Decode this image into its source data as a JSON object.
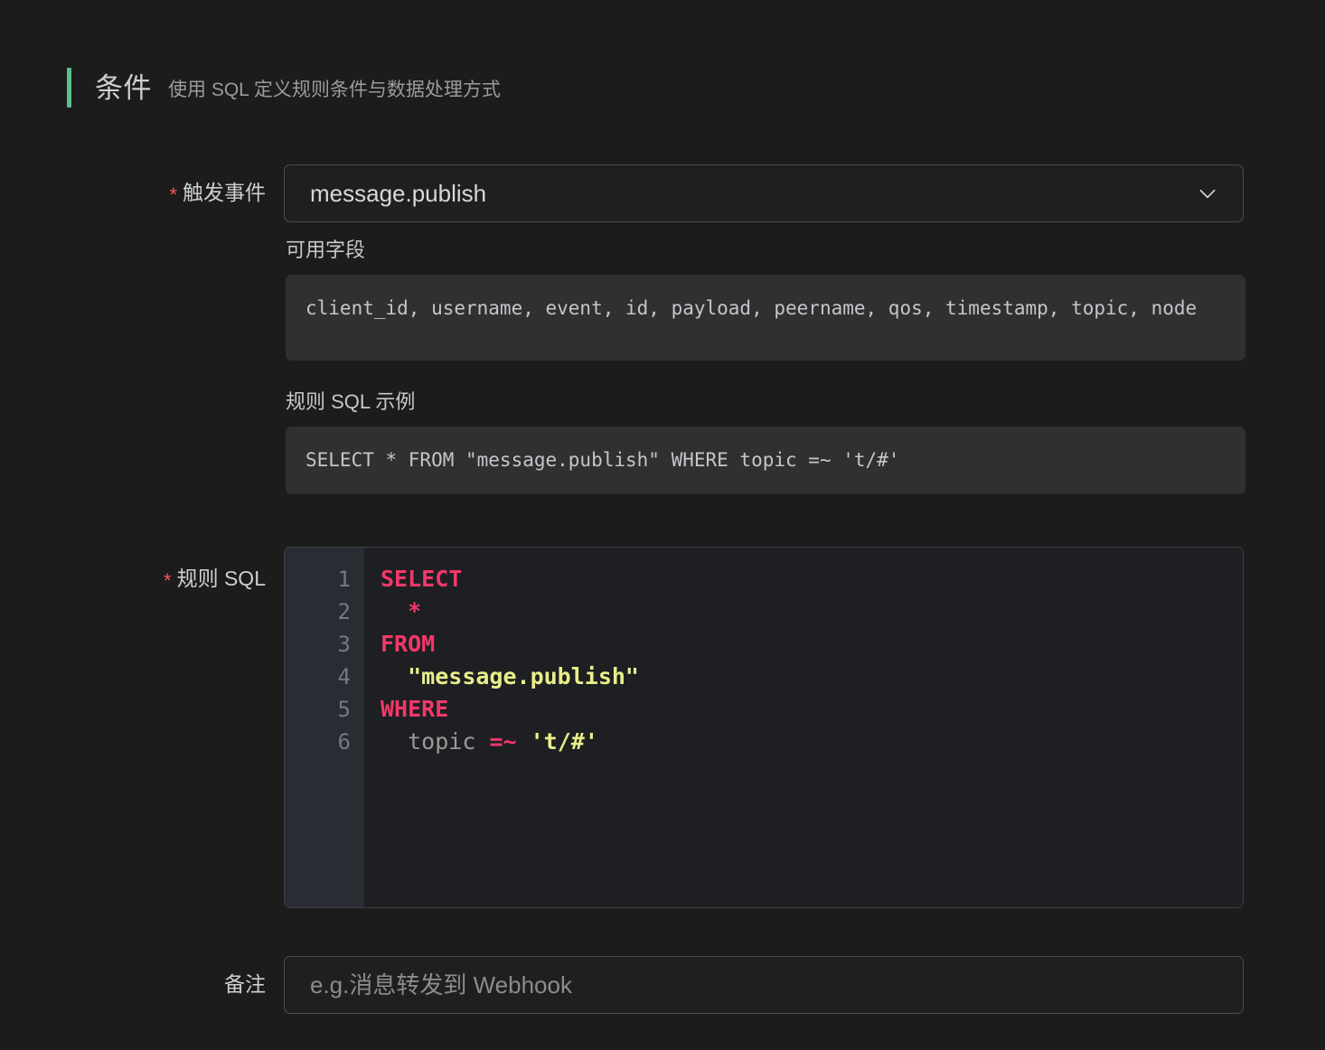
{
  "section": {
    "title": "条件",
    "subtitle": "使用 SQL 定义规则条件与数据处理方式",
    "accent_color": "#5cbf8a"
  },
  "trigger_event": {
    "label": "触发事件",
    "required_mark": "*",
    "value": "message.publish",
    "dropdown_icon": "chevron-down-icon"
  },
  "available_fields": {
    "title": "可用字段",
    "value": "client_id, username, event, id, payload, peername, qos, timestamp, topic, node"
  },
  "sql_example": {
    "title": "规则 SQL 示例",
    "value": "SELECT * FROM \"message.publish\" WHERE topic =~ 't/#'"
  },
  "rule_sql": {
    "label": "规则 SQL",
    "required_mark": "*",
    "line_numbers": [
      "1",
      "2",
      "3",
      "4",
      "5",
      "6"
    ],
    "lines": [
      {
        "n": "1",
        "tokens": [
          {
            "t": "SELECT",
            "k": "kw"
          }
        ]
      },
      {
        "n": "2",
        "tokens": [
          {
            "t": "  ",
            "k": "plain"
          },
          {
            "t": "*",
            "k": "op"
          }
        ]
      },
      {
        "n": "3",
        "tokens": [
          {
            "t": "FROM",
            "k": "kw"
          }
        ]
      },
      {
        "n": "4",
        "tokens": [
          {
            "t": "  ",
            "k": "plain"
          },
          {
            "t": "\"message.publish\"",
            "k": "str"
          }
        ]
      },
      {
        "n": "5",
        "tokens": [
          {
            "t": "WHERE",
            "k": "kw"
          }
        ]
      },
      {
        "n": "6",
        "tokens": [
          {
            "t": "  ",
            "k": "plain"
          },
          {
            "t": "topic",
            "k": "id"
          },
          {
            "t": " ",
            "k": "plain"
          },
          {
            "t": "=~",
            "k": "op"
          },
          {
            "t": " ",
            "k": "plain"
          },
          {
            "t": "'t/#'",
            "k": "str"
          }
        ]
      }
    ],
    "plain_text": "SELECT\n  *\nFROM\n  \"message.publish\"\nWHERE\n  topic =~ 't/#'",
    "colors": {
      "keyword": "#f2386a",
      "string": "#e9ee8b",
      "identifier": "#9a9a9a",
      "line_number": "#6e7c80",
      "gutter_bg": "#2a2c33",
      "editor_bg": "#1e1f22"
    }
  },
  "note": {
    "label": "备注",
    "value": "",
    "placeholder": "e.g.消息转发到 Webhook"
  }
}
